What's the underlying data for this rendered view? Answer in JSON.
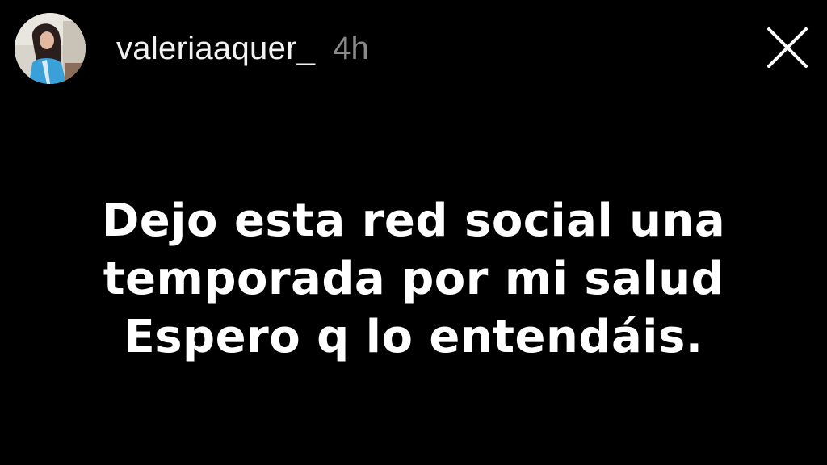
{
  "story": {
    "username": "valeriaaquer_",
    "timestamp": "4h",
    "avatar_icon": "profile-photo",
    "close_icon": "close-x-icon",
    "message_lines": [
      "Dejo esta red social una",
      "temporada por mi salud",
      "Espero q lo entendáis."
    ]
  },
  "colors": {
    "background": "#000000",
    "text": "#ffffff",
    "timestamp": "#8a8a8a"
  }
}
